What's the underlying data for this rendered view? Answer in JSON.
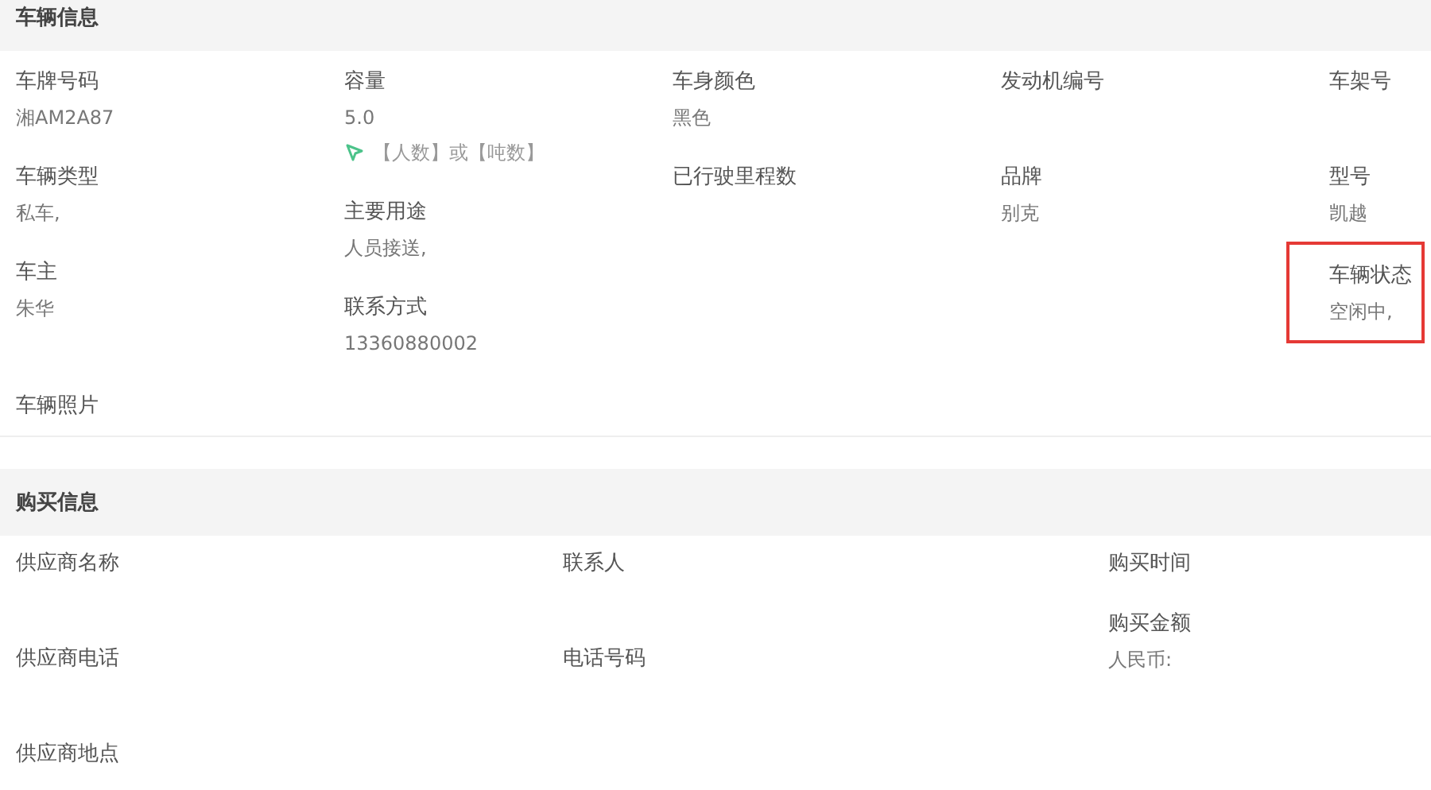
{
  "vehicle_info": {
    "title": "车辆信息",
    "columns": [
      [
        {
          "label": "车牌号码",
          "value": "湘AM2A87",
          "highlighted": false
        },
        {
          "label": "车辆类型",
          "value": "私车,",
          "highlighted": false
        },
        {
          "label": "车主",
          "value": "朱华",
          "highlighted": false
        }
      ],
      [
        {
          "label": "容量",
          "value": "5.0",
          "hint": "【人数】或【吨数】",
          "highlighted": false
        },
        {
          "label": "主要用途",
          "value": "人员接送,",
          "highlighted": false
        },
        {
          "label": "联系方式",
          "value": "13360880002",
          "highlighted": false
        }
      ],
      [
        {
          "label": "车身颜色",
          "value": "黑色",
          "highlighted": false
        },
        {
          "label": "已行驶里程数",
          "highlighted": false
        }
      ],
      [
        {
          "label": "发动机编号",
          "highlighted": false
        },
        {
          "label": "品牌",
          "value": "别克",
          "highlighted": false
        }
      ],
      [
        {
          "label": "车架号",
          "highlighted": false
        },
        {
          "label": "型号",
          "value": "凯越",
          "highlighted": false
        },
        {
          "label": "车辆状态",
          "value": "空闲中,",
          "highlighted": true
        }
      ]
    ],
    "photo": {
      "label": "车辆照片"
    }
  },
  "purchase_info": {
    "title": "购买信息",
    "rows": [
      [
        {
          "label": "供应商名称"
        },
        {
          "label": "联系人"
        },
        {
          "label": "购买时间"
        }
      ],
      [
        {
          "label": "供应商电话"
        },
        {
          "label": "电话号码"
        },
        {
          "label": "购买金额",
          "value": "人民币:"
        }
      ],
      [
        {
          "label": "供应商地点"
        }
      ]
    ]
  }
}
